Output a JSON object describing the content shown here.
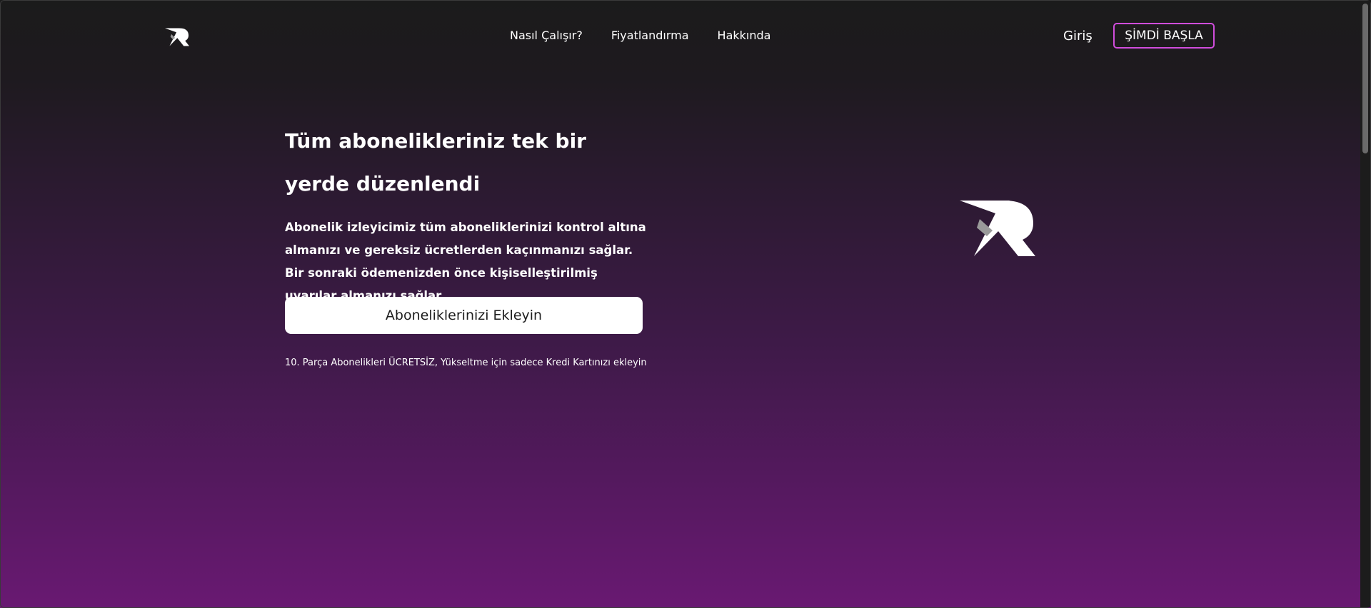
{
  "header": {
    "logo_icon": "brand-logo-icon",
    "nav": [
      {
        "label": "Nasıl Çalışır?"
      },
      {
        "label": "Fiyatlandırma"
      },
      {
        "label": "Hakkında"
      }
    ],
    "login_label": "Giriş",
    "cta_label": "ŞİMDİ BAŞLA"
  },
  "hero": {
    "title": "Tüm abonelikleriniz tek bir yerde düzenlendi",
    "description": "Abonelik izleyicimiz tüm aboneliklerinizi kontrol altına almanızı ve gereksiz ücretlerden kaçınmanızı sağlar. Bir sonraki ödemenizden önce kişiselleştirilmiş uyarılar almanızı sağlar.",
    "button_label": "Aboneliklerinizi Ekleyin",
    "footnote": "10. Parça Abonelikleri ÜCRETSİZ, Yükseltme için sadece Kredi Kartınızı ekleyin",
    "graphic_icon": "brand-logo-large-icon"
  },
  "colors": {
    "accent_border": "#d04ddc",
    "gradient_top": "#1b1b1b",
    "gradient_bottom": "#691972"
  }
}
